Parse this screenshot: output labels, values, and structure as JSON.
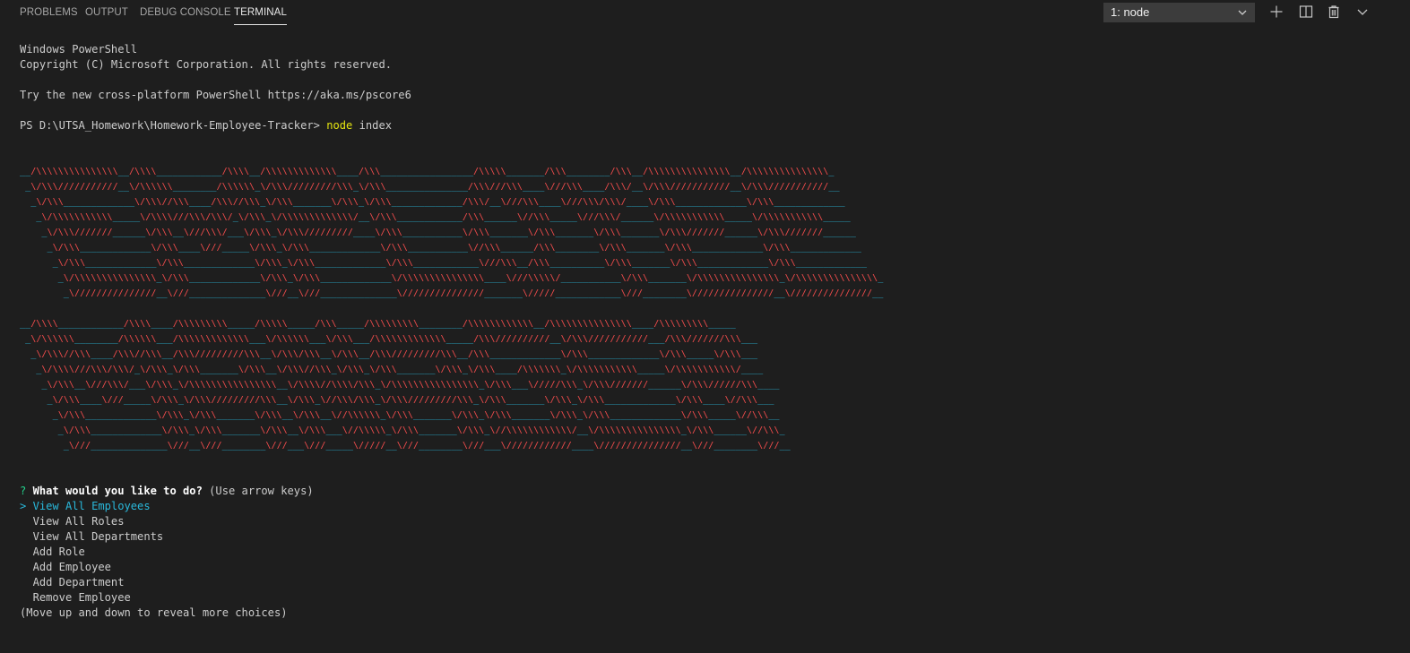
{
  "tabs": [
    {
      "label": "PROBLEMS"
    },
    {
      "label": "OUTPUT"
    },
    {
      "label": "DEBUG CONSOLE"
    },
    {
      "label": "TERMINAL",
      "active": true
    }
  ],
  "toolbar": {
    "terminal_select": "1: node",
    "icons": [
      "plus-icon",
      "split-terminal-icon",
      "trash-icon",
      "chevron-down-icon"
    ]
  },
  "terminal": {
    "header_lines": [
      "Windows PowerShell",
      "Copyright (C) Microsoft Corporation. All rights reserved.",
      "",
      "Try the new cross-platform PowerShell https://aka.ms/pscore6",
      ""
    ],
    "prompt": "PS D:\\UTSA_Homework\\Homework-Employee-Tracker> ",
    "command": "node",
    "command_args": " index",
    "banner_colors": {
      "slash": "#f14c4c",
      "underscore": "#29b8db"
    },
    "banner_block1": [
      "__/\\\\\\\\\\\\\\\\\\\\\\\\\\\\\\__/\\\\\\\\____________/\\\\\\\\__/\\\\\\\\\\\\\\\\\\\\\\\\\\____/\\\\\\_________________/\\\\\\\\\\_______/\\\\\\________/\\\\\\__/\\\\\\\\\\\\\\\\\\\\\\\\\\\\\\__/\\\\\\\\\\\\\\\\\\\\\\\\\\\\\\_",
      " _\\/\\\\\\///////////__\\/\\\\\\\\\\\\________/\\\\\\\\\\\\_\\/\\\\\\/////////\\\\\\_\\/\\\\\\_______________/\\\\\\///\\\\\\____\\///\\\\\\____/\\\\\\/__\\/\\\\\\///////////__\\/\\\\\\///////////__",
      "  _\\/\\\\\\_____________\\/\\\\\\//\\\\\\____/\\\\\\//\\\\\\_\\/\\\\\\_______\\/\\\\\\_\\/\\\\\\_____________/\\\\\\/__\\///\\\\\\____\\///\\\\\\/\\\\\\/____\\/\\\\\\_____________\\/\\\\\\_____________",
      "   _\\/\\\\\\\\\\\\\\\\\\\\\\_____\\/\\\\\\\\///\\\\\\/\\\\\\/_\\/\\\\\\_\\/\\\\\\\\\\\\\\\\\\\\\\\\\\/__\\/\\\\\\____________/\\\\\\______\\//\\\\\\_____\\///\\\\\\/______\\/\\\\\\\\\\\\\\\\\\\\\\_____\\/\\\\\\\\\\\\\\\\\\\\\\_____",
      "    _\\/\\\\\\///////______\\/\\\\\\__\\///\\\\\\/___\\/\\\\\\_\\/\\\\\\/////////____\\/\\\\\\___________\\/\\\\\\_______\\/\\\\\\_______\\/\\\\\\_______\\/\\\\\\///////______\\/\\\\\\///////______",
      "     _\\/\\\\\\_____________\\/\\\\\\____\\///_____\\/\\\\\\_\\/\\\\\\_____________\\/\\\\\\___________\\//\\\\\\______/\\\\\\________\\/\\\\\\_______\\/\\\\\\_____________\\/\\\\\\_____________",
      "      _\\/\\\\\\_____________\\/\\\\\\_____________\\/\\\\\\_\\/\\\\\\_____________\\/\\\\\\____________\\///\\\\\\__/\\\\\\__________\\/\\\\\\_______\\/\\\\\\_____________\\/\\\\\\_____________",
      "       _\\/\\\\\\\\\\\\\\\\\\\\\\\\\\\\\\_\\/\\\\\\_____________\\/\\\\\\_\\/\\\\\\_____________\\/\\\\\\\\\\\\\\\\\\\\\\\\\\\\\\____\\///\\\\\\\\\\/___________\\/\\\\\\_______\\/\\\\\\\\\\\\\\\\\\\\\\\\\\\\\\_\\/\\\\\\\\\\\\\\\\\\\\\\\\\\\\\\_",
      "        _\\///////////////__\\///______________\\///__\\///______________\\///////////////_______\\/////____________\\///________\\///////////////__\\///////////////__"
    ],
    "banner_block2": [
      "__/\\\\\\\\____________/\\\\\\\\____/\\\\\\\\\\\\\\\\\\_____/\\\\\\\\\\_____/\\\\\\_____/\\\\\\\\\\\\\\\\\\________/\\\\\\\\\\\\\\\\\\\\\\\\__/\\\\\\\\\\\\\\\\\\\\\\\\\\\\\\____/\\\\\\\\\\\\\\\\\\_____",
      " _\\/\\\\\\\\\\\\________/\\\\\\\\\\\\___/\\\\\\\\\\\\\\\\\\\\\\\\\\___\\/\\\\\\\\\\\\___\\/\\\\\\___/\\\\\\\\\\\\\\\\\\\\\\\\\\_____/\\\\\\//////////__\\/\\\\\\///////////___/\\\\\\///////\\\\\\___",
      "  _\\/\\\\\\//\\\\\\____/\\\\\\//\\\\\\__/\\\\\\/////////\\\\\\__\\/\\\\\\/\\\\\\__\\/\\\\\\__/\\\\\\/////////\\\\\\__/\\\\\\_____________\\/\\\\\\_____________\\/\\\\\\_____\\/\\\\\\___",
      "   _\\/\\\\\\\\///\\\\\\/\\\\\\/_\\/\\\\\\_\\/\\\\\\_______\\/\\\\\\__\\/\\\\\\//\\\\\\_\\/\\\\\\_\\/\\\\\\_______\\/\\\\\\_\\/\\\\\\____/\\\\\\\\\\\\\\_\\/\\\\\\\\\\\\\\\\\\\\\\_____\\/\\\\\\\\\\\\\\\\\\\\\\/____",
      "    _\\/\\\\\\__\\///\\\\\\/___\\/\\\\\\_\\/\\\\\\\\\\\\\\\\\\\\\\\\\\\\\\\\__\\/\\\\\\\\//\\\\\\\\/\\\\\\_\\/\\\\\\\\\\\\\\\\\\\\\\\\\\\\\\\\_\\/\\\\\\___\\/////\\\\\\_\\/\\\\\\///////______\\/\\\\\\//////\\\\\\____",
      "     _\\/\\\\\\____\\///_____\\/\\\\\\_\\/\\\\\\/////////\\\\\\__\\/\\\\\\_\\//\\\\\\/\\\\\\_\\/\\\\\\/////////\\\\\\_\\/\\\\\\_______\\/\\\\\\_\\/\\\\\\_____________\\/\\\\\\____\\//\\\\\\___",
      "      _\\/\\\\\\_____________\\/\\\\\\_\\/\\\\\\_______\\/\\\\\\__\\/\\\\\\__\\//\\\\\\\\\\\\_\\/\\\\\\_______\\/\\\\\\_\\/\\\\\\_______\\/\\\\\\_\\/\\\\\\_____________\\/\\\\\\_____\\//\\\\\\__",
      "       _\\/\\\\\\_____________\\/\\\\\\_\\/\\\\\\_______\\/\\\\\\__\\/\\\\\\___\\//\\\\\\\\\\_\\/\\\\\\_______\\/\\\\\\_\\//\\\\\\\\\\\\\\\\\\\\\\\\/__\\/\\\\\\\\\\\\\\\\\\\\\\\\\\\\\\_\\/\\\\\\______\\//\\\\\\_",
      "        _\\///______________\\///__\\///________\\///___\\///_____\\/////__\\///________\\///___\\////////////____\\///////////////__\\///________\\///__"
    ],
    "question_mark": "?",
    "question": "What would you like to do?",
    "question_hint": " (Use arrow keys)",
    "pointer": ">",
    "choices": [
      "View All Employees",
      "View All Roles",
      "View All Departments",
      "Add Role",
      "Add Employee",
      "Add Department",
      "Remove Employee"
    ],
    "selected_index": 0,
    "footer": "(Move up and down to reveal more choices)"
  }
}
